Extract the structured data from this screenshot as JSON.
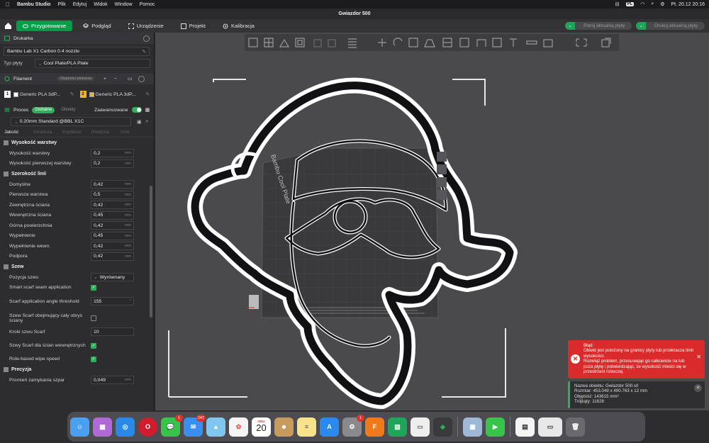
{
  "menubar": {
    "app_name": "Bambu Studio",
    "items": [
      "Plik",
      "Edytuj",
      "Widok",
      "Window",
      "Pomoc"
    ],
    "input_source": "PL",
    "clock": "Pt. 20.12  20:16"
  },
  "window": {
    "title": "Gwiazdor 500"
  },
  "tabs": [
    {
      "label": "Przygotowanie",
      "active": true
    },
    {
      "label": "Podgląd"
    },
    {
      "label": "Urządzenie"
    },
    {
      "label": "Projekt"
    },
    {
      "label": "Kalibracja"
    }
  ],
  "actions": {
    "slice_label": "Potnij aktualną płytę",
    "print_label": "Drukuj aktualną płytę"
  },
  "printer": {
    "section_label": "Drukarka",
    "name": "Bambu Lab X1 Carbon 0.4 nozzle",
    "plate_type_label": "Typ płyty",
    "plate_type": "Cool Plate/PLA Plate"
  },
  "filament": {
    "section_label": "Filament",
    "flush_label": "Objętości płukania",
    "slots": [
      {
        "num": "1",
        "name": "Generic PLA  3dP...",
        "color": "#ffffff"
      },
      {
        "num": "2",
        "name": "Generic PLA  3dP...",
        "color": "#f0b42a"
      }
    ]
  },
  "process": {
    "section_label": "Proces",
    "global_label": "Globalne",
    "objects_label": "Obiekty",
    "advanced_label": "Zaawansowane",
    "preset": "0.20mm Standard @BBL X1C",
    "subtabs": [
      "Jakość",
      "Struktura",
      "Prędkość",
      "Podpora",
      "Inne"
    ]
  },
  "groups": {
    "layer_height": {
      "title": "Wysokość warstwy",
      "params": [
        {
          "label": "Wysokość warstwy",
          "value": "0,2",
          "unit": "mm"
        },
        {
          "label": "Wysokość pierwszej warstwy",
          "value": "0,2",
          "unit": "mm"
        }
      ]
    },
    "line_width": {
      "title": "Szerokość linii",
      "params": [
        {
          "label": "Domyślne",
          "value": "0,42",
          "unit": "mm"
        },
        {
          "label": "Pierwsza warstwa",
          "value": "0,5",
          "unit": "mm"
        },
        {
          "label": "Zewnętrzna ściana",
          "value": "0,42",
          "unit": "mm"
        },
        {
          "label": "Wewnętrzna ściana",
          "value": "0,45",
          "unit": "mm"
        },
        {
          "label": "Górna powierzchnia",
          "value": "0,42",
          "unit": "mm"
        },
        {
          "label": "Wypełnienie",
          "value": "0,45",
          "unit": "mm"
        },
        {
          "label": "Wypełnienie wewn.",
          "value": "0,42",
          "unit": "mm"
        },
        {
          "label": "Podpora",
          "value": "0,42",
          "unit": "mm"
        }
      ]
    },
    "seam": {
      "title": "Szew",
      "position_label": "Pozycja szwu",
      "position_value": "Wyrównany",
      "scarf_app_label": "Smart scarf seam application",
      "scarf_angle_label": "Scarf application angle threshold",
      "scarf_angle_value": "155",
      "scarf_angle_unit": "°",
      "scarf_full_label": "Szew Scarf obejmujący cały obrys ściany",
      "scarf_steps_label": "Kroki szwu Scarf",
      "scarf_steps_value": "10",
      "scarf_inner_label": "Szwy Scarf dla ścian wewnętrznych",
      "wipe_label": "Role-based wipe speed"
    },
    "precision": {
      "title": "Precyzja",
      "closing_label": "Promień zamykania szpar",
      "closing_value": "0,049",
      "closing_unit": "mm"
    }
  },
  "viewport": {
    "plate_label": "Bambu Cool Plate"
  },
  "toast_error": {
    "title": "Błąd:",
    "line1": "Obiekt jest położony na granicy płyty lub przekracza limit wysokości.",
    "line2": "Rozwiąż problem, przesuwając go całkowicie na lub poza płytę i potwierdzając, że wysokość mieści się w przestrzeni roboczej."
  },
  "toast_info": {
    "name": "Nazwa obiektu: Gwiazdor 500.stl",
    "size": "Rozmiar: 453.049 x 490.763 x 12 mm",
    "volume": "Objętość: 143615 mm³",
    "triangles": "Trójkąty: 11628"
  },
  "dock": {
    "messages_badge": "1",
    "mail_badge": "247",
    "settings_badge": "1",
    "calendar_month": "GRU",
    "calendar_day": "20"
  }
}
